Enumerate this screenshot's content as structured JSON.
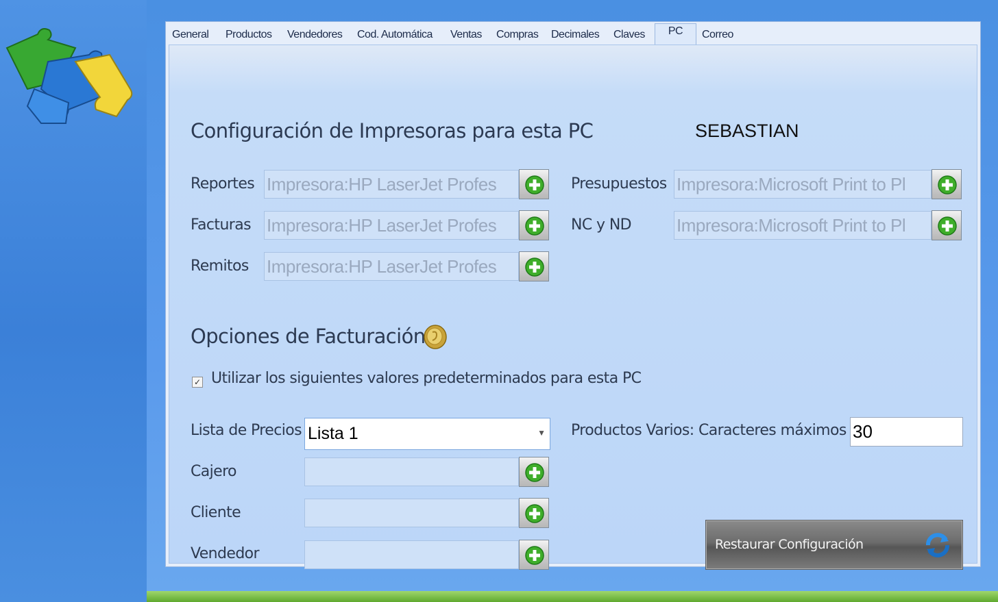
{
  "tabs": [
    {
      "label": "General"
    },
    {
      "label": "Productos"
    },
    {
      "label": "Vendedores"
    },
    {
      "label": "Cod. Automática"
    },
    {
      "label": "Ventas"
    },
    {
      "label": "Compras"
    },
    {
      "label": "Decimales"
    },
    {
      "label": "Claves"
    },
    {
      "label": "PC",
      "active": true
    },
    {
      "label": "Correo"
    }
  ],
  "printers": {
    "heading": "Configuración de Impresoras para esta PC",
    "pc_name": "SEBASTIAN",
    "reportes_label": "Reportes",
    "reportes_value": "Impresora:HP LaserJet Profes",
    "facturas_label": "Facturas",
    "facturas_value": "Impresora:HP LaserJet Profes",
    "remitos_label": "Remitos",
    "remitos_value": "Impresora:HP LaserJet Profes",
    "presupuestos_label": "Presupuestos",
    "presupuestos_value": "Impresora:Microsoft Print to Pl",
    "ncnd_label": "NC y ND",
    "ncnd_value": "Impresora:Microsoft Print to Pl"
  },
  "billing": {
    "heading": "Opciones de Facturación",
    "checkbox_label": "Utilizar los siguientes valores predeterminados para esta PC",
    "checkbox_checked": true,
    "lista_label": "Lista de Precios",
    "lista_value": "Lista 1",
    "cajero_label": "Cajero",
    "cliente_label": "Cliente",
    "vendedor_label": "Vendedor",
    "max_chars_label": "Productos Varios: Caracteres máximos",
    "max_chars_value": "30",
    "restore_label": "Restaurar Configuración"
  },
  "colors": {
    "accent_green": "#3fae2a",
    "panel_bg": "#c5dcf8"
  },
  "icons": [
    "puzzle-logo-icon",
    "add-icon",
    "coin-icon",
    "refresh-icon",
    "chevron-down-icon"
  ]
}
